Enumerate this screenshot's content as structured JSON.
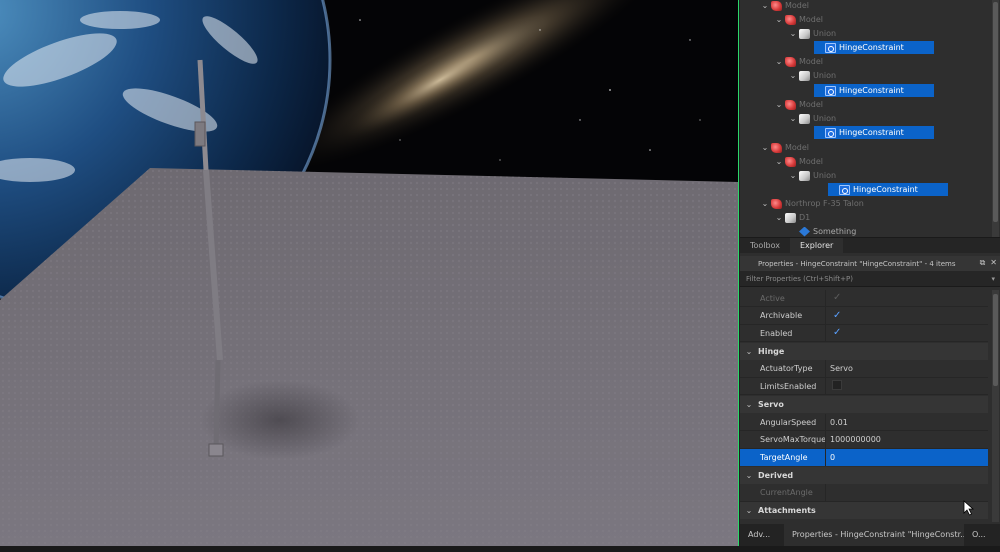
{
  "explorer": {
    "rows": [
      {
        "label": "Model",
        "icon": "model-icon",
        "chev": "⌄",
        "faded": true,
        "selected": false
      },
      {
        "label": "Model",
        "icon": "model-icon",
        "chev": "⌄",
        "faded": true,
        "selected": false
      },
      {
        "label": "Union",
        "icon": "union-icon",
        "chev": "⌄",
        "faded": true,
        "selected": false
      },
      {
        "label": "HingeConstraint",
        "icon": "hinge-constraint-icon",
        "chev": "",
        "faded": false,
        "selected": true
      },
      {
        "label": "Model",
        "icon": "model-icon",
        "chev": "⌄",
        "faded": true,
        "selected": false
      },
      {
        "label": "Union",
        "icon": "union-icon",
        "chev": "⌄",
        "faded": true,
        "selected": false
      },
      {
        "label": "HingeConstraint",
        "icon": "hinge-constraint-icon",
        "chev": "",
        "faded": false,
        "selected": true
      },
      {
        "label": "Model",
        "icon": "model-icon",
        "chev": "⌄",
        "faded": true,
        "selected": false
      },
      {
        "label": "Union",
        "icon": "union-icon",
        "chev": "⌄",
        "faded": true,
        "selected": false
      },
      {
        "label": "HingeConstraint",
        "icon": "hinge-constraint-icon",
        "chev": "",
        "faded": false,
        "selected": true
      },
      {
        "label": "Model",
        "icon": "model-icon",
        "chev": "⌄",
        "faded": true,
        "selected": false
      },
      {
        "label": "Model",
        "icon": "model-icon",
        "chev": "⌄",
        "faded": true,
        "selected": false
      },
      {
        "label": "Union",
        "icon": "union-icon",
        "chev": "⌄",
        "faded": true,
        "selected": false
      },
      {
        "label": "HingeConstraint",
        "icon": "hinge-constraint-icon",
        "chev": "",
        "faded": false,
        "selected": true
      },
      {
        "label": "Northrop F-35 Talon",
        "icon": "model-icon",
        "chev": "⌄",
        "faded": true,
        "selected": false
      },
      {
        "label": "D1",
        "icon": "union-icon",
        "chev": "⌄",
        "faded": true,
        "selected": false
      },
      {
        "label": "Something",
        "icon": "script-icon",
        "chev": "",
        "faded": false,
        "selected": false
      }
    ]
  },
  "tabs": {
    "toolbox": "Toolbox",
    "explorer": "Explorer"
  },
  "properties": {
    "header_title": "Properties - HingeConstraint \"HingeConstraint\" - 4 items",
    "filter_placeholder": "Filter Properties (Ctrl+Shift+P)",
    "rows": [
      {
        "kind": "prop",
        "name": "Active",
        "value": "",
        "checkbox": "on",
        "disabled": true
      },
      {
        "kind": "prop",
        "name": "Archivable",
        "value": "",
        "checkbox": "on",
        "disabled": false
      },
      {
        "kind": "prop",
        "name": "Enabled",
        "value": "",
        "checkbox": "on",
        "disabled": false
      },
      {
        "kind": "cat",
        "name": "Hinge"
      },
      {
        "kind": "prop",
        "name": "ActuatorType",
        "value": "Servo",
        "checkbox": "",
        "disabled": false
      },
      {
        "kind": "prop",
        "name": "LimitsEnabled",
        "value": "",
        "checkbox": "off",
        "disabled": false
      },
      {
        "kind": "cat",
        "name": "Servo"
      },
      {
        "kind": "prop",
        "name": "AngularSpeed",
        "value": "0.01",
        "checkbox": "",
        "disabled": false
      },
      {
        "kind": "prop",
        "name": "ServoMaxTorque",
        "value": "1000000000",
        "checkbox": "",
        "disabled": false
      },
      {
        "kind": "prop",
        "name": "TargetAngle",
        "value": "0",
        "checkbox": "",
        "disabled": false,
        "selected": true
      },
      {
        "kind": "cat",
        "name": "Derived"
      },
      {
        "kind": "prop",
        "name": "CurrentAngle",
        "value": "",
        "checkbox": "",
        "disabled": true
      },
      {
        "kind": "cat",
        "name": "Attachments"
      }
    ]
  },
  "bottom_tabs": {
    "adv": "Adv...",
    "properties": "Properties - HingeConstraint \"HingeConstr...",
    "o": "O..."
  },
  "colors": {
    "selection": "#0b63c9",
    "viewport_border": "#2bd66a",
    "panel_bg": "#2e2e2e"
  }
}
